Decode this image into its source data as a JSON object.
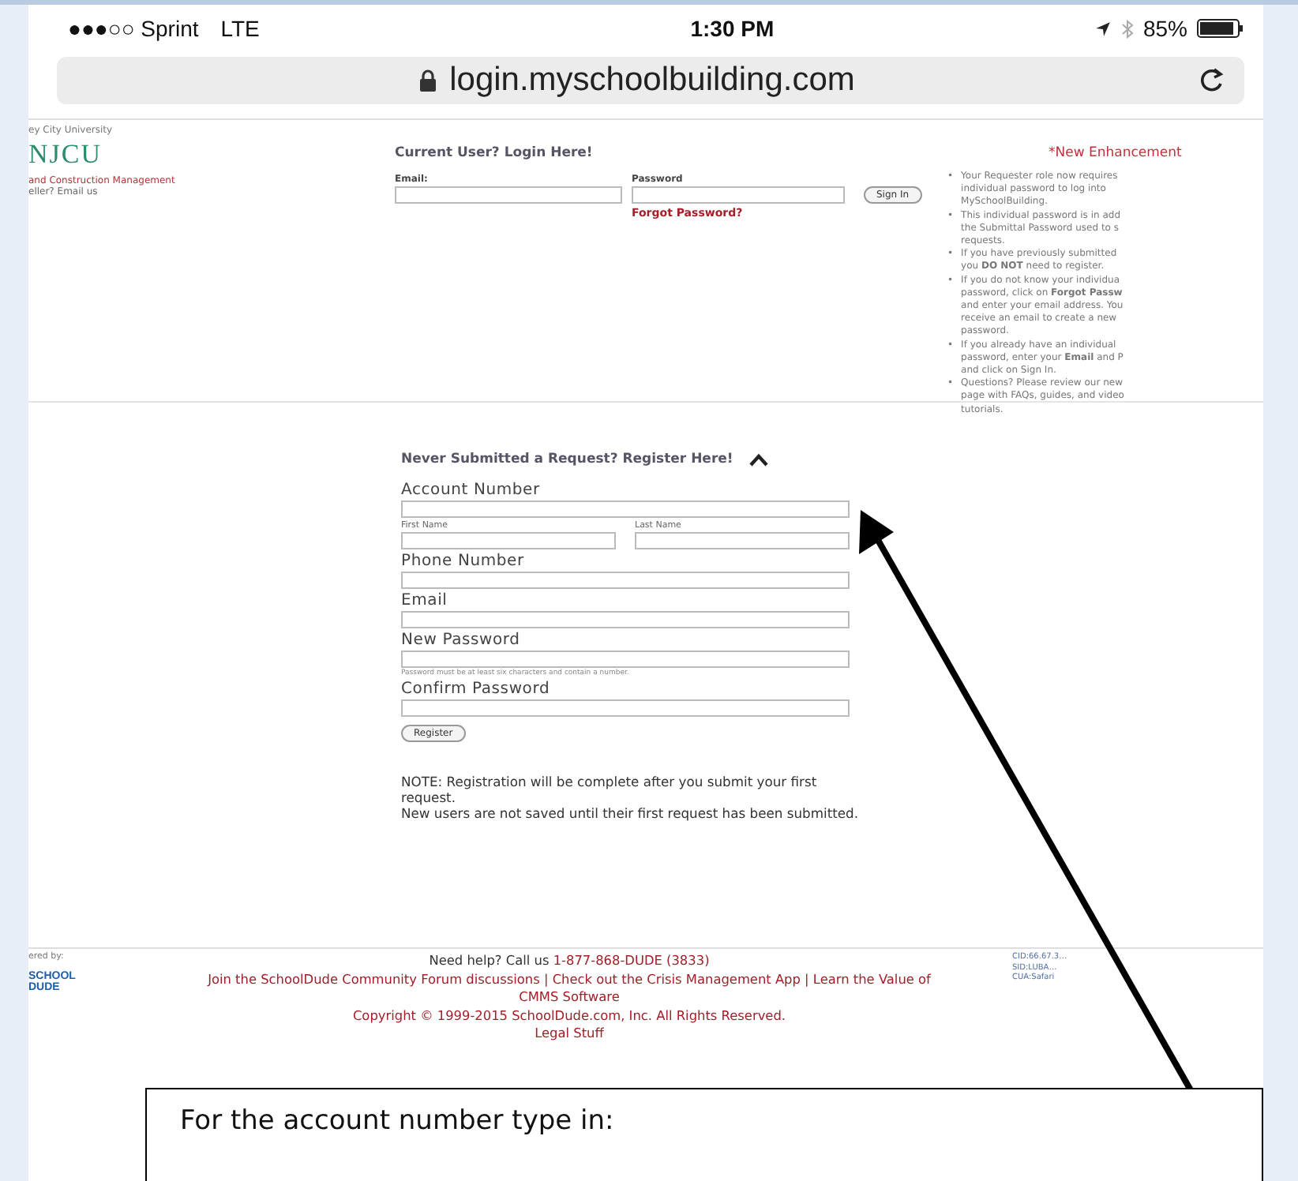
{
  "status_bar": {
    "carrier": "●●●○○ Sprint",
    "network": "LTE",
    "time": "1:30 PM",
    "battery": "85%"
  },
  "address_bar": {
    "url": "login.myschoolbuilding.com"
  },
  "sidebar": {
    "university": "ey City University",
    "logo": "NJCU",
    "lines": [
      "and Construction Management",
      "eller? Email us"
    ]
  },
  "login": {
    "title": "Current User? Login Here!",
    "email_label": "Email:",
    "password_label": "Password",
    "sign_in": "Sign In",
    "forgot": "Forgot Password?"
  },
  "enhancements": {
    "title": "*New Enhancement",
    "bullets": [
      {
        "marker": "•",
        "lines": [
          "Your Requester role now requires",
          "individual password to log into",
          "MySchoolBuilding."
        ]
      },
      {
        "marker": "•",
        "lines": [
          "This individual password is in add",
          "the Submittal Password used to s",
          "requests."
        ]
      },
      {
        "marker": "•",
        "lines": [
          "If you have previously submitted",
          "you **DO NOT** need to register."
        ]
      },
      {
        "marker": "•",
        "lines": [
          "If you do not know your individua",
          "password, click on **Forgot Passw**",
          "and enter your email address. You",
          "receive an email to create a new",
          "password."
        ]
      },
      {
        "marker": "•",
        "lines": [
          "If you already have an individual",
          "password, enter your **Email** and P",
          "and click on Sign In."
        ]
      },
      {
        "marker": "•",
        "lines": [
          "Questions? Please review our new",
          "page with FAQs, guides, and video",
          "tutorials."
        ]
      }
    ]
  },
  "register": {
    "title": "Never Submitted a Request? Register Here!",
    "expanded": true,
    "rows": [
      [
        {
          "label": "Account Number",
          "kind": "large"
        }
      ],
      [
        {
          "label": "First Name",
          "kind": "small"
        },
        {
          "label": "Last Name",
          "kind": "small"
        }
      ],
      [
        {
          "label": "Phone Number",
          "kind": "large"
        }
      ],
      [
        {
          "label": "Email",
          "kind": "large"
        }
      ],
      [
        {
          "label": "New Password",
          "kind": "large",
          "hint": "Password must be at least six characters and contain a number."
        }
      ],
      [
        {
          "label": "Confirm Password",
          "kind": "large"
        }
      ]
    ],
    "button": "Register",
    "notes": [
      "NOTE: Registration will be complete after you submit your first request.",
      "New users are not saved until their first request has been submitted."
    ]
  },
  "footer": {
    "powered_by": "ered by:",
    "logo": [
      "SCHOOL",
      "DUDE"
    ],
    "help": "Need help? Call us",
    "phone": "1-877-868-DUDE (3833)",
    "links": "Join the SchoolDude Community Forum discussions | Check out the Crisis Management App | Learn the Value of CMMS Software",
    "copyright": "Copyright © 1999-2015 SchoolDude.com, Inc. All Rights Reserved.",
    "legal": "Legal Stuff",
    "info": [
      "CID:66.67.3…",
      "SID:LUBA…",
      "CUA:Safari"
    ]
  },
  "callout": {
    "text": "For the account number type in:"
  }
}
